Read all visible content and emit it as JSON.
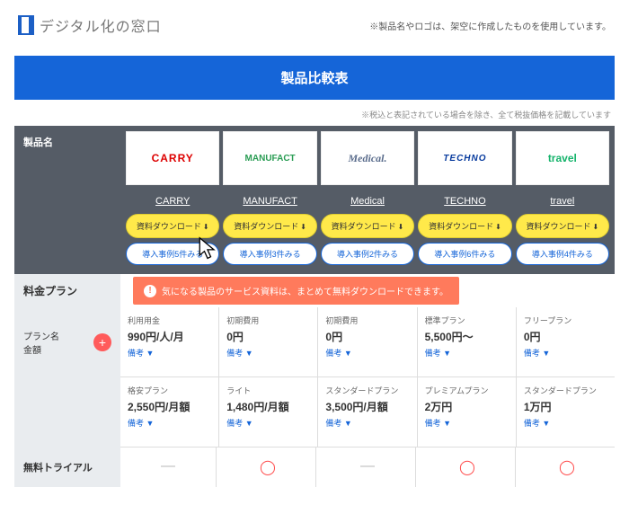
{
  "header": {
    "logo_text": "デジタル化の窓口",
    "disclaimer": "※製品名やロゴは、架空に作成したものを使用しています。"
  },
  "title": "製品比較表",
  "note": "※税込と表記されている場合を除き、全て税抜価格を記載しています",
  "section_product": "製品名",
  "section_price": "料金プラン",
  "plan_label_line1": "プラン名",
  "plan_label_line2": "金額",
  "section_trial": "無料トライアル",
  "alert": "気になる製品のサービス資料は、まとめて無料ダウンロードできます。",
  "download_label": "資料ダウンロード",
  "remark": "備考 ▼",
  "products": [
    {
      "name": "CARRY",
      "logo_class": "carry",
      "logo_text": "CARRY",
      "cases": "導入事例5件みる",
      "trial": "—",
      "plan1": {
        "t": "利用用金",
        "v": "990円/人/月"
      },
      "plan2": {
        "t": "格安プラン",
        "v": "2,550円/月額"
      }
    },
    {
      "name": "MANUFACT",
      "logo_class": "manufact",
      "logo_text": "MANUFACT",
      "cases": "導入事例3件みる",
      "trial": "◯",
      "plan1": {
        "t": "初期費用",
        "v": "0円"
      },
      "plan2": {
        "t": "ライト",
        "v": "1,480円/月額"
      }
    },
    {
      "name": "Medical",
      "logo_class": "medical",
      "logo_text": "Medical.",
      "cases": "導入事例2件みる",
      "trial": "—",
      "plan1": {
        "t": "初期費用",
        "v": "0円"
      },
      "plan2": {
        "t": "スタンダードプラン",
        "v": "3,500円/月額"
      }
    },
    {
      "name": "TECHNO",
      "logo_class": "techno",
      "logo_text": "TECHNO",
      "cases": "導入事例6件みる",
      "trial": "◯",
      "plan1": {
        "t": "標準プラン",
        "v": "5,500円〜"
      },
      "plan2": {
        "t": "プレミアムプラン",
        "v": "2万円"
      }
    },
    {
      "name": "travel",
      "logo_class": "travel",
      "logo_text": "travel",
      "cases": "導入事例4件みる",
      "trial": "◯",
      "plan1": {
        "t": "フリープラン",
        "v": "0円"
      },
      "plan2": {
        "t": "スタンダードプラン",
        "v": "1万円"
      }
    }
  ]
}
